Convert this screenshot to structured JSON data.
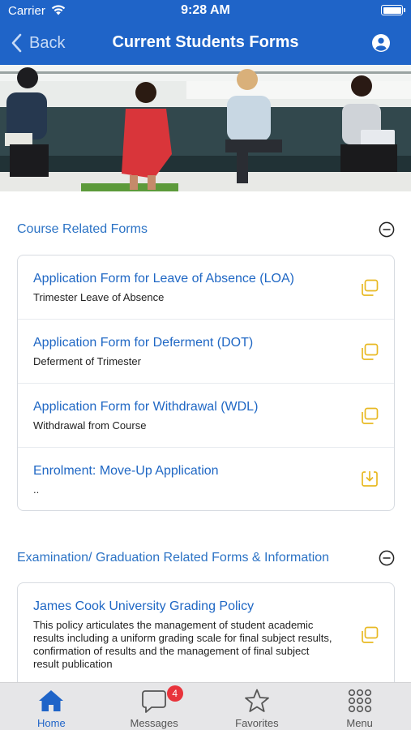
{
  "status_bar": {
    "carrier": "Carrier",
    "time": "9:28 AM"
  },
  "nav": {
    "back_label": "Back",
    "title": "Current Students Forms"
  },
  "sections": [
    {
      "title": "Course Related Forms",
      "items": [
        {
          "title": "Application Form for Leave of Absence (LOA)",
          "subtitle": "Trimester Leave of Absence",
          "icon": "copy-icon"
        },
        {
          "title": "Application Form for Deferment (DOT)",
          "subtitle": "Deferment of Trimester",
          "icon": "copy-icon"
        },
        {
          "title": "Application Form for Withdrawal (WDL)",
          "subtitle": "Withdrawal from Course",
          "icon": "copy-icon"
        },
        {
          "title": "Enrolment: Move-Up Application",
          "subtitle": "..",
          "icon": "download-icon"
        }
      ]
    },
    {
      "title": "Examination/ Graduation Related Forms & Information",
      "items": [
        {
          "title": "James Cook University Grading Policy",
          "subtitle": "This policy articulates the management of student academic results including a uniform grading scale for final subject results, confirmation of results and the management of final subject result publication",
          "icon": "copy-icon"
        }
      ]
    }
  ],
  "tabbar": {
    "home": "Home",
    "messages": "Messages",
    "messages_badge": "4",
    "favorites": "Favorites",
    "menu": "Menu"
  },
  "colors": {
    "header": "#1f64c8",
    "link": "#1f67c4",
    "icon_accent": "#e8b923",
    "badge": "#e8333b"
  }
}
